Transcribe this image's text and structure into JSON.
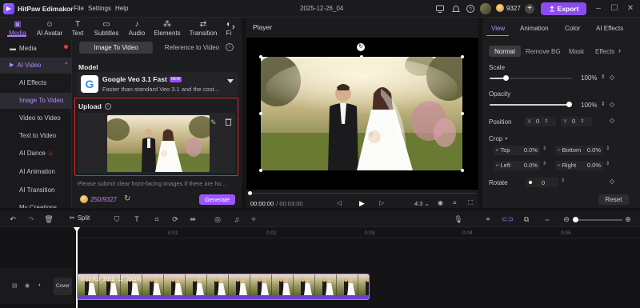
{
  "app": {
    "title": "HitPaw Edimakor",
    "menu": [
      "File",
      "Settings",
      "Help"
    ],
    "project_name": "2025-12-26_04",
    "credits": "9327",
    "export_label": "Export"
  },
  "toolbar_tabs": [
    "Media",
    "AI Avatar",
    "Text",
    "Subtitles",
    "Audio",
    "Elements",
    "Transition",
    "Fi"
  ],
  "sidebar": {
    "media": "Media",
    "ai_video": "AI Video",
    "items": [
      "AI Effects",
      "Image To Video",
      "Video to Video",
      "Text to Video",
      "AI Dance",
      "AI Animation",
      "AI Transition",
      "My Creations"
    ]
  },
  "modes": {
    "image_to_video": "Image To Video",
    "reference_to_video": "Reference to Video"
  },
  "model": {
    "label": "Model",
    "name": "Google Veo 3.1 Fast",
    "badge": "NEW",
    "desc": "Faster than standard Veo 3.1 and the cost..."
  },
  "upload": {
    "label": "Upload",
    "hint": "Please submit clear front-facing images if there are hu..."
  },
  "generate": {
    "cost": "250/9327",
    "label": "Generate"
  },
  "player": {
    "title": "Player",
    "time_current": "00:00:00",
    "time_total": "/ 00:03:00",
    "ratio": "4:3"
  },
  "right": {
    "tabs": [
      "View",
      "Animation",
      "Color",
      "AI Effects"
    ],
    "subtabs": [
      "Normal",
      "Remove BG",
      "Mask",
      "Effects"
    ],
    "scale_label": "Scale",
    "scale_value": "100%",
    "opacity_label": "Opacity",
    "opacity_value": "100%",
    "position_label": "Position",
    "pos_x_label": "X",
    "pos_x": "0",
    "pos_y_label": "Y",
    "pos_y": "0",
    "crop_label": "Crop",
    "crop": [
      {
        "label": "Top",
        "value": "0.0%"
      },
      {
        "label": "Bottom",
        "value": "0.0%"
      },
      {
        "label": "Left",
        "value": "0.0%"
      },
      {
        "label": "Right",
        "value": "0.0%"
      }
    ],
    "rotate_label": "Rotate",
    "rotate_value": "0",
    "reset_label": "Reset"
  },
  "timeline": {
    "split_label": "Split",
    "ruler": [
      "0:01",
      "0:02",
      "0:03",
      "0:04",
      "0:05"
    ],
    "cover_label": "Cover",
    "clip_label": "0:03 R2i_2025_12_26(10)"
  }
}
